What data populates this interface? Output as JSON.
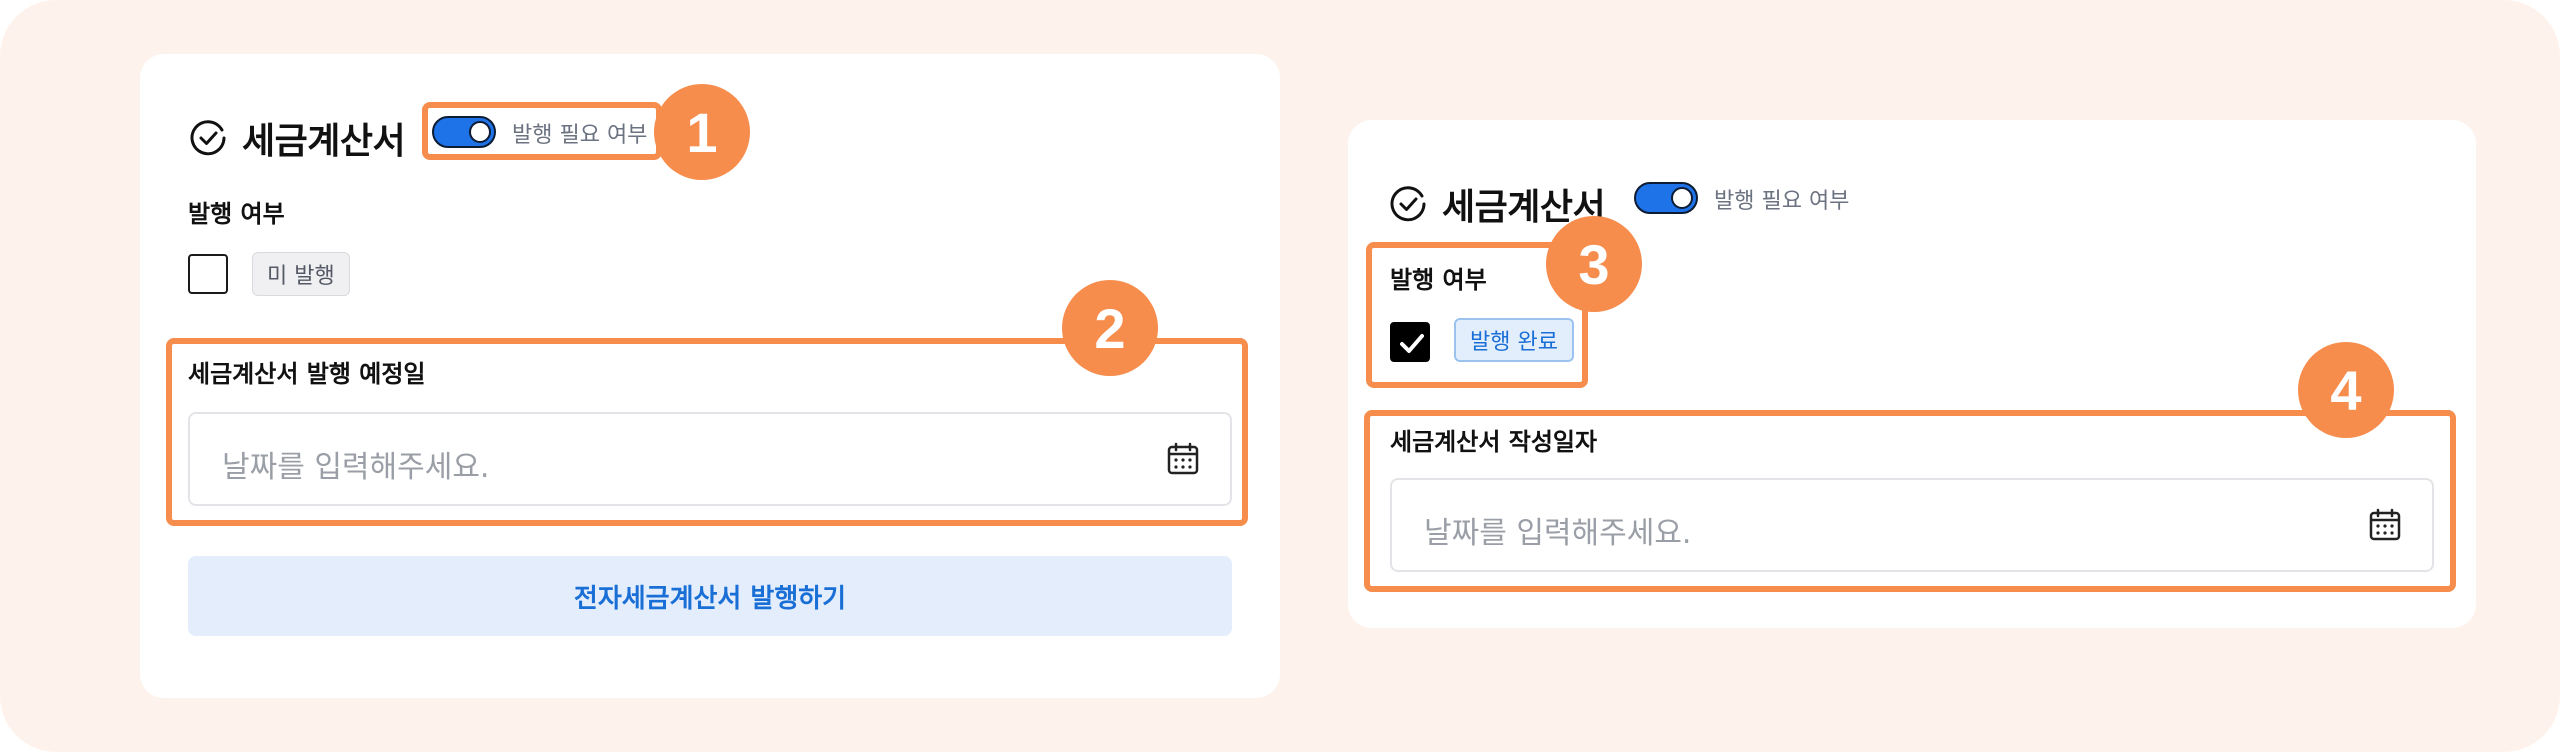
{
  "colors": {
    "background": "#fef3ec",
    "highlight": "#f78d4d",
    "accent_blue": "#1e73e8",
    "button_bg": "#e3edfb"
  },
  "left_panel": {
    "title": "세금계산서",
    "title_icon": "check-circle-icon",
    "toggle": {
      "state": "on",
      "label": "발행 필요 여부"
    },
    "issue_status_label": "발행 여부",
    "checkbox_checked": false,
    "badge": "미 발행",
    "date_field": {
      "label": "세금계산서 발행 예정일",
      "placeholder": "날짜를 입력해주세요.",
      "icon": "calendar-icon"
    },
    "submit_button": "전자세금계산서 발행하기"
  },
  "right_panel": {
    "title": "세금계산서",
    "title_icon": "check-circle-icon",
    "toggle": {
      "state": "on",
      "label": "발행 필요 여부"
    },
    "issue_status_label": "발행 여부",
    "checkbox_checked": true,
    "badge": "발행 완료",
    "date_field": {
      "label": "세금계산서 작성일자",
      "placeholder": "날짜를 입력해주세요.",
      "icon": "calendar-icon"
    }
  },
  "markers": [
    "1",
    "2",
    "3",
    "4"
  ]
}
